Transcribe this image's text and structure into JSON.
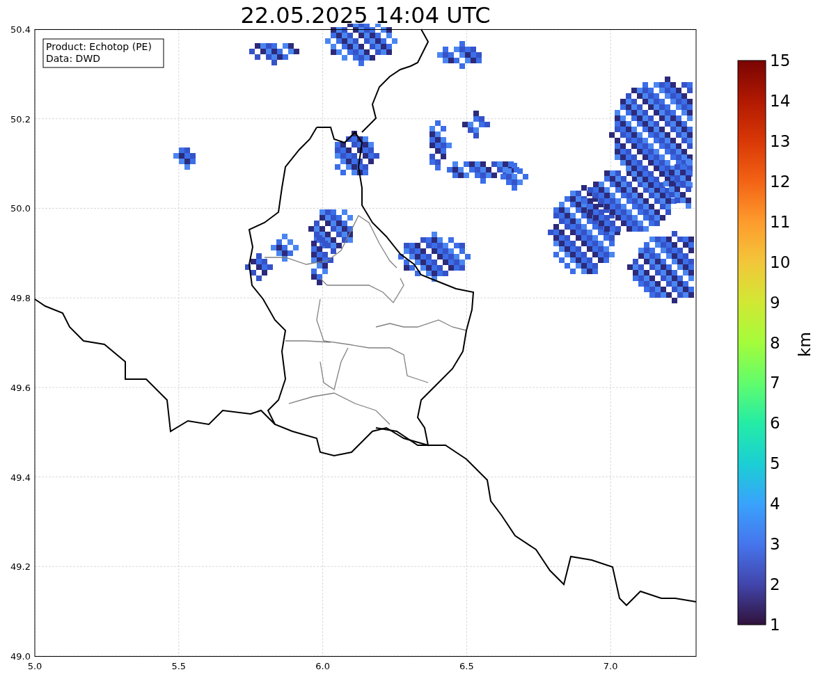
{
  "title": "22.05.2025 14:04 UTC",
  "info_box": {
    "lines": [
      "Product: Echotop (PE)",
      "Data: DWD"
    ]
  },
  "x_ticks": [
    "5.0",
    "5.5",
    "6.0",
    "6.5",
    "7.0"
  ],
  "y_ticks": [
    "50.4",
    "50.2",
    "50.0",
    "49.8",
    "49.6",
    "49.4",
    "49.2",
    "49.0"
  ],
  "colorbar": {
    "label": "km",
    "ticks": [
      "15",
      "14",
      "13",
      "12",
      "11",
      "10",
      "9",
      "8",
      "7",
      "6",
      "5",
      "4",
      "3",
      "2",
      "1"
    ]
  }
}
